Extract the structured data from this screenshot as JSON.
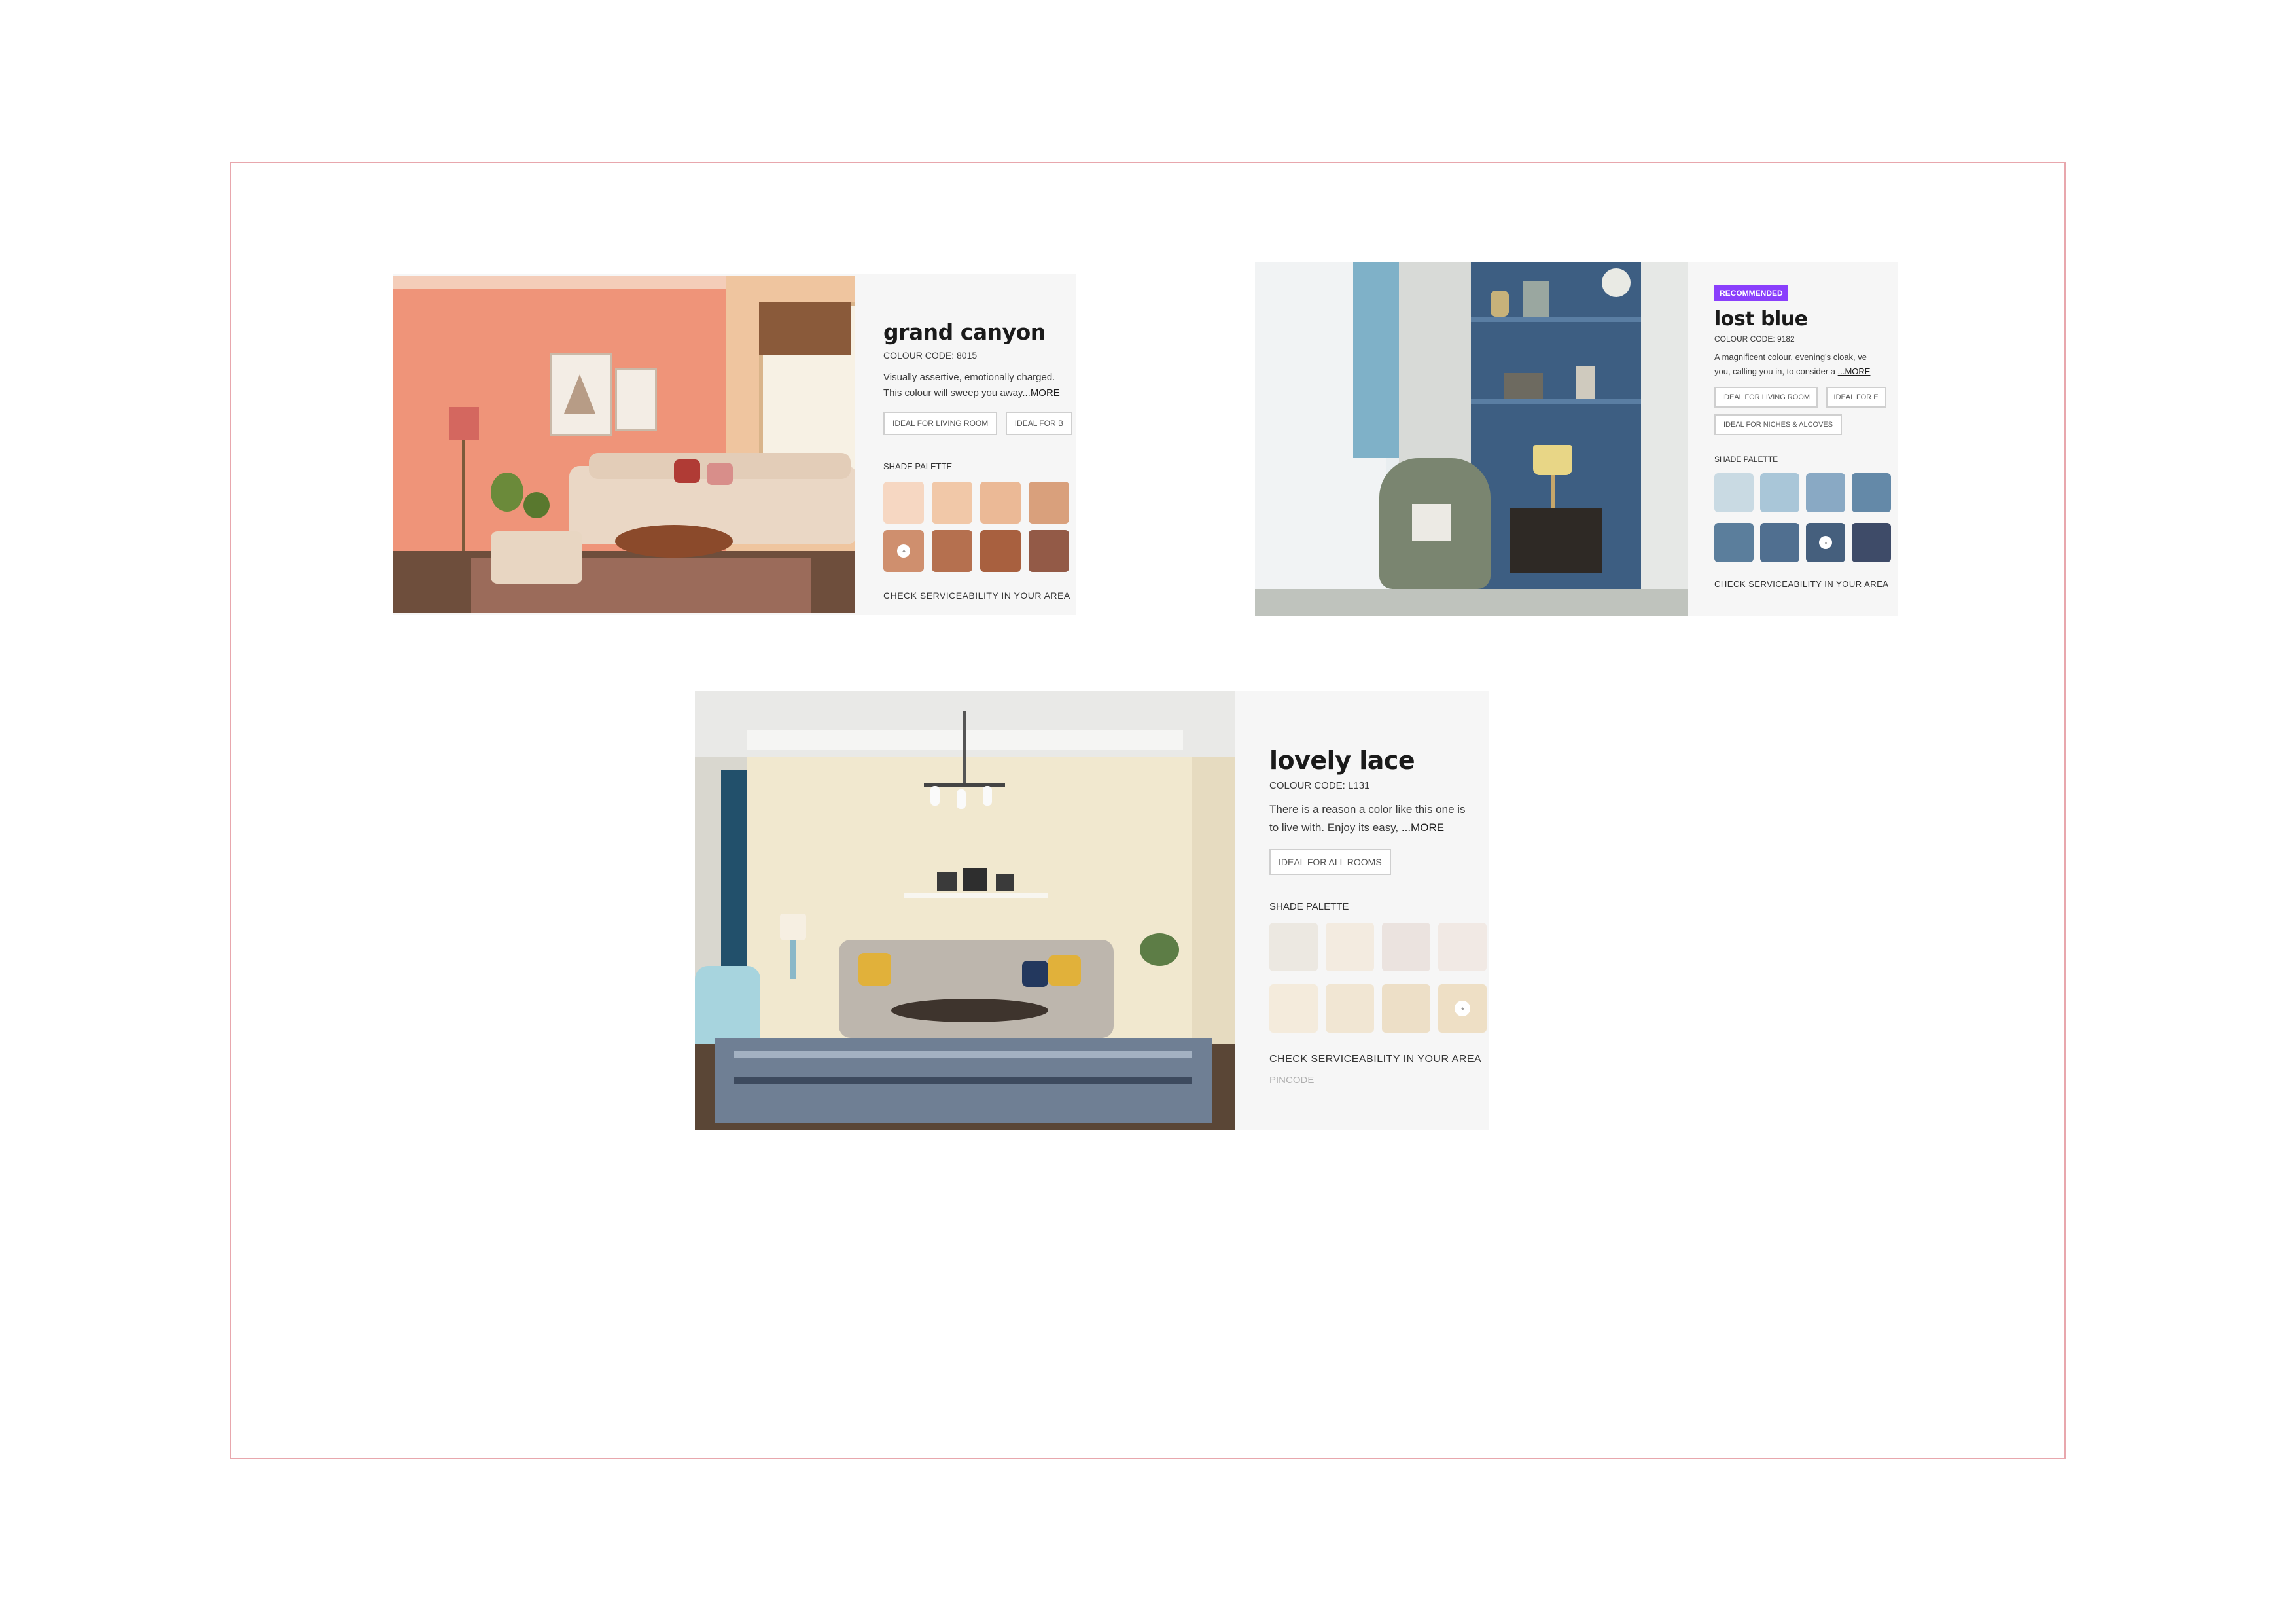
{
  "colors": {
    "frame_border": "#e8a7ad",
    "panel_bg": "#f6f6f6",
    "badge_bg": "#8a3ffc"
  },
  "cards": [
    {
      "id": "grand-canyon",
      "title": "grand canyon",
      "colour_code": "COLOUR CODE: 8015",
      "description_line1": "Visually assertive, emotionally charged.",
      "description_line2": "This colour will sweep you away",
      "more_link": "...MORE",
      "tags": [
        "IDEAL FOR LIVING ROOM",
        "IDEAL FOR B"
      ],
      "shade_palette_label": "SHADE PALETTE",
      "swatches": [
        "#f6d7c2",
        "#f1c8a8",
        "#ebb996",
        "#d9a07c",
        "#cf8f6e",
        "#b5704f",
        "#a8603f",
        "#935a47"
      ],
      "selected_swatch": 5,
      "check_label": "CHECK SERVICEABILITY IN YOUR AREA",
      "wall_color": "#ef9479"
    },
    {
      "id": "lost-blue",
      "badge": "RECOMMENDED",
      "title": "lost blue",
      "colour_code": "COLOUR CODE: 9182",
      "description_line1": "A magnificent colour, evening's cloak, ve",
      "description_line2": "you, calling you in, to consider a",
      "more_link": "...MORE",
      "tags": [
        "IDEAL FOR LIVING ROOM",
        "IDEAL FOR E",
        "IDEAL FOR NICHES & ALCOVES"
      ],
      "shade_palette_label": "SHADE PALETTE",
      "swatches": [
        "#c9dae3",
        "#a9c6d8",
        "#89a9c4",
        "#6489a8",
        "#5b7e9c",
        "#506f90",
        "#455f7d",
        "#3e4b68"
      ],
      "selected_swatch": 7,
      "check_label": "CHECK SERVICEABILITY IN YOUR AREA",
      "wall_color": "#3d5e82"
    },
    {
      "id": "lovely-lace",
      "title": "lovely lace",
      "colour_code": "COLOUR CODE: L131",
      "description_line1": "There is a reason a color like this one is",
      "description_line2": "to live with. Enjoy its easy,",
      "more_link": "...MORE",
      "tags": [
        "IDEAL FOR ALL ROOMS"
      ],
      "shade_palette_label": "SHADE PALETTE",
      "swatches": [
        "#ece8e1",
        "#f3ebe0",
        "#ebe3df",
        "#f1e9e4",
        "#f4ebdc",
        "#f1e6d3",
        "#eddfc7",
        "#eedfc5"
      ],
      "selected_swatch": 8,
      "check_label": "CHECK SERVICEABILITY IN YOUR AREA",
      "pincode_placeholder": "PINCODE",
      "wall_color": "#f1e8cf"
    }
  ]
}
